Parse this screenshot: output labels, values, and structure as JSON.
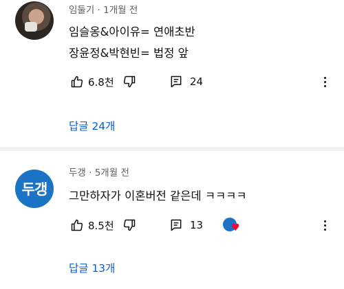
{
  "comments": [
    {
      "author": "임둘기",
      "time": "1개월 전",
      "lines": [
        "임슬옹&아이유= 연애초반",
        "장윤정&박현빈= 법정 앞"
      ],
      "likes": "6.8천",
      "reply_count": "24",
      "replies_link": "답글 24개"
    },
    {
      "author": "두갱",
      "avatar_text": "두갱",
      "time": "5개월 전",
      "lines": [
        "그만하자가 이혼버전 같은데 ㅋㅋㅋㅋ"
      ],
      "likes": "8.5천",
      "reply_count": "13",
      "replies_link": "답글 13개",
      "creator_heart": true
    }
  ],
  "separator": " · ",
  "colors": {
    "link": "#065fd4",
    "meta": "#606060",
    "avatar_blue": "#1b73c6",
    "heart": "#ff0033"
  },
  "icons": [
    "like-icon",
    "dislike-icon",
    "reply-icon",
    "more-vert-icon",
    "creator-heart-icon"
  ]
}
